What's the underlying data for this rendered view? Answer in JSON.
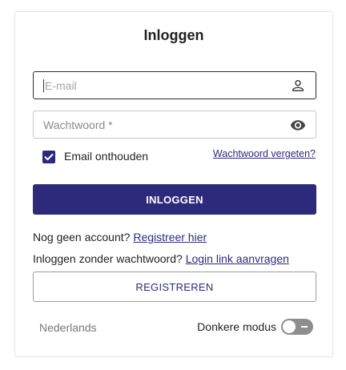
{
  "login": {
    "title": "Inloggen",
    "email_placeholder": "E-mail",
    "password_placeholder": "Wachtwoord *",
    "remember_label": "Email onthouden",
    "remember_checked": true,
    "forgot_link": "Wachtwoord vergeten?",
    "login_button": "INLOGGEN",
    "no_account_text": "Nog geen account?",
    "register_link": "Registreer hier",
    "passwordless_text": "Inloggen zonder wachtwoord?",
    "passwordless_link": "Login link aanvragen",
    "register_button": "REGISTREREN"
  },
  "footer": {
    "language": "Nederlands",
    "dark_mode_label": "Donkere modus",
    "dark_mode_on": false
  },
  "colors": {
    "primary": "#2d2a7c",
    "toggle_off": "#8e8e8e"
  },
  "icons": {
    "email_field": "person-icon",
    "password_field": "eye-icon",
    "remember": "checkmark-icon"
  }
}
